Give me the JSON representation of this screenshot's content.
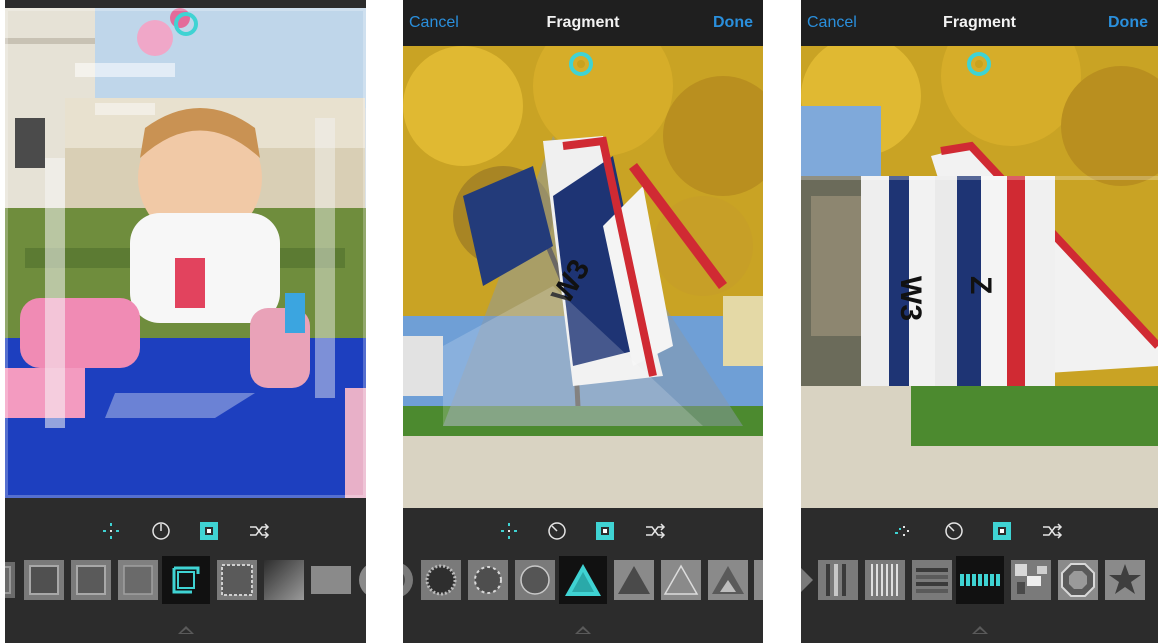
{
  "screens": [
    {
      "id": "party",
      "nav": null,
      "tools": [
        "move-tool-icon",
        "rotate-tool-icon",
        "frame-tool-icon",
        "shuffle-tool-icon"
      ],
      "active_tool": 2,
      "shapes": [
        "square-frame",
        "square-frame",
        "square-frame",
        "corner-frame",
        "ornate-frame",
        "square-gradient",
        "rectangle",
        "circle-partial"
      ],
      "selected_shape": 3
    },
    {
      "id": "flag-triangle",
      "nav": {
        "cancel": "Cancel",
        "title": "Fragment",
        "done": "Done"
      },
      "tools": [
        "move-tool-icon",
        "rotate-tool-icon",
        "frame-tool-icon",
        "shuffle-tool-icon"
      ],
      "active_tool": 2,
      "shapes": [
        "circle-partial",
        "sunburst-ring",
        "dotted-ring",
        "thin-ring",
        "triangle",
        "triangle-filled",
        "triangle-outline",
        "triangle-split",
        "triangle-partial"
      ],
      "selected_shape": 4
    },
    {
      "id": "flag-stripes",
      "nav": {
        "cancel": "Cancel",
        "title": "Fragment",
        "done": "Done"
      },
      "tools": [
        "move-tool-icon",
        "rotate-tool-icon",
        "frame-tool-icon",
        "shuffle-tool-icon"
      ],
      "active_tool": 2,
      "shapes": [
        "diamond-partial",
        "stripes-vertical",
        "stripes-thin",
        "stripes-horizontal",
        "stripes-selected",
        "blocks",
        "octagon-ring",
        "star"
      ],
      "selected_shape": 4
    }
  ],
  "colors": {
    "accent": "#3fd3d3",
    "nav_link": "#2a8fdc",
    "toolbar_bg": "#2c2c2c"
  }
}
